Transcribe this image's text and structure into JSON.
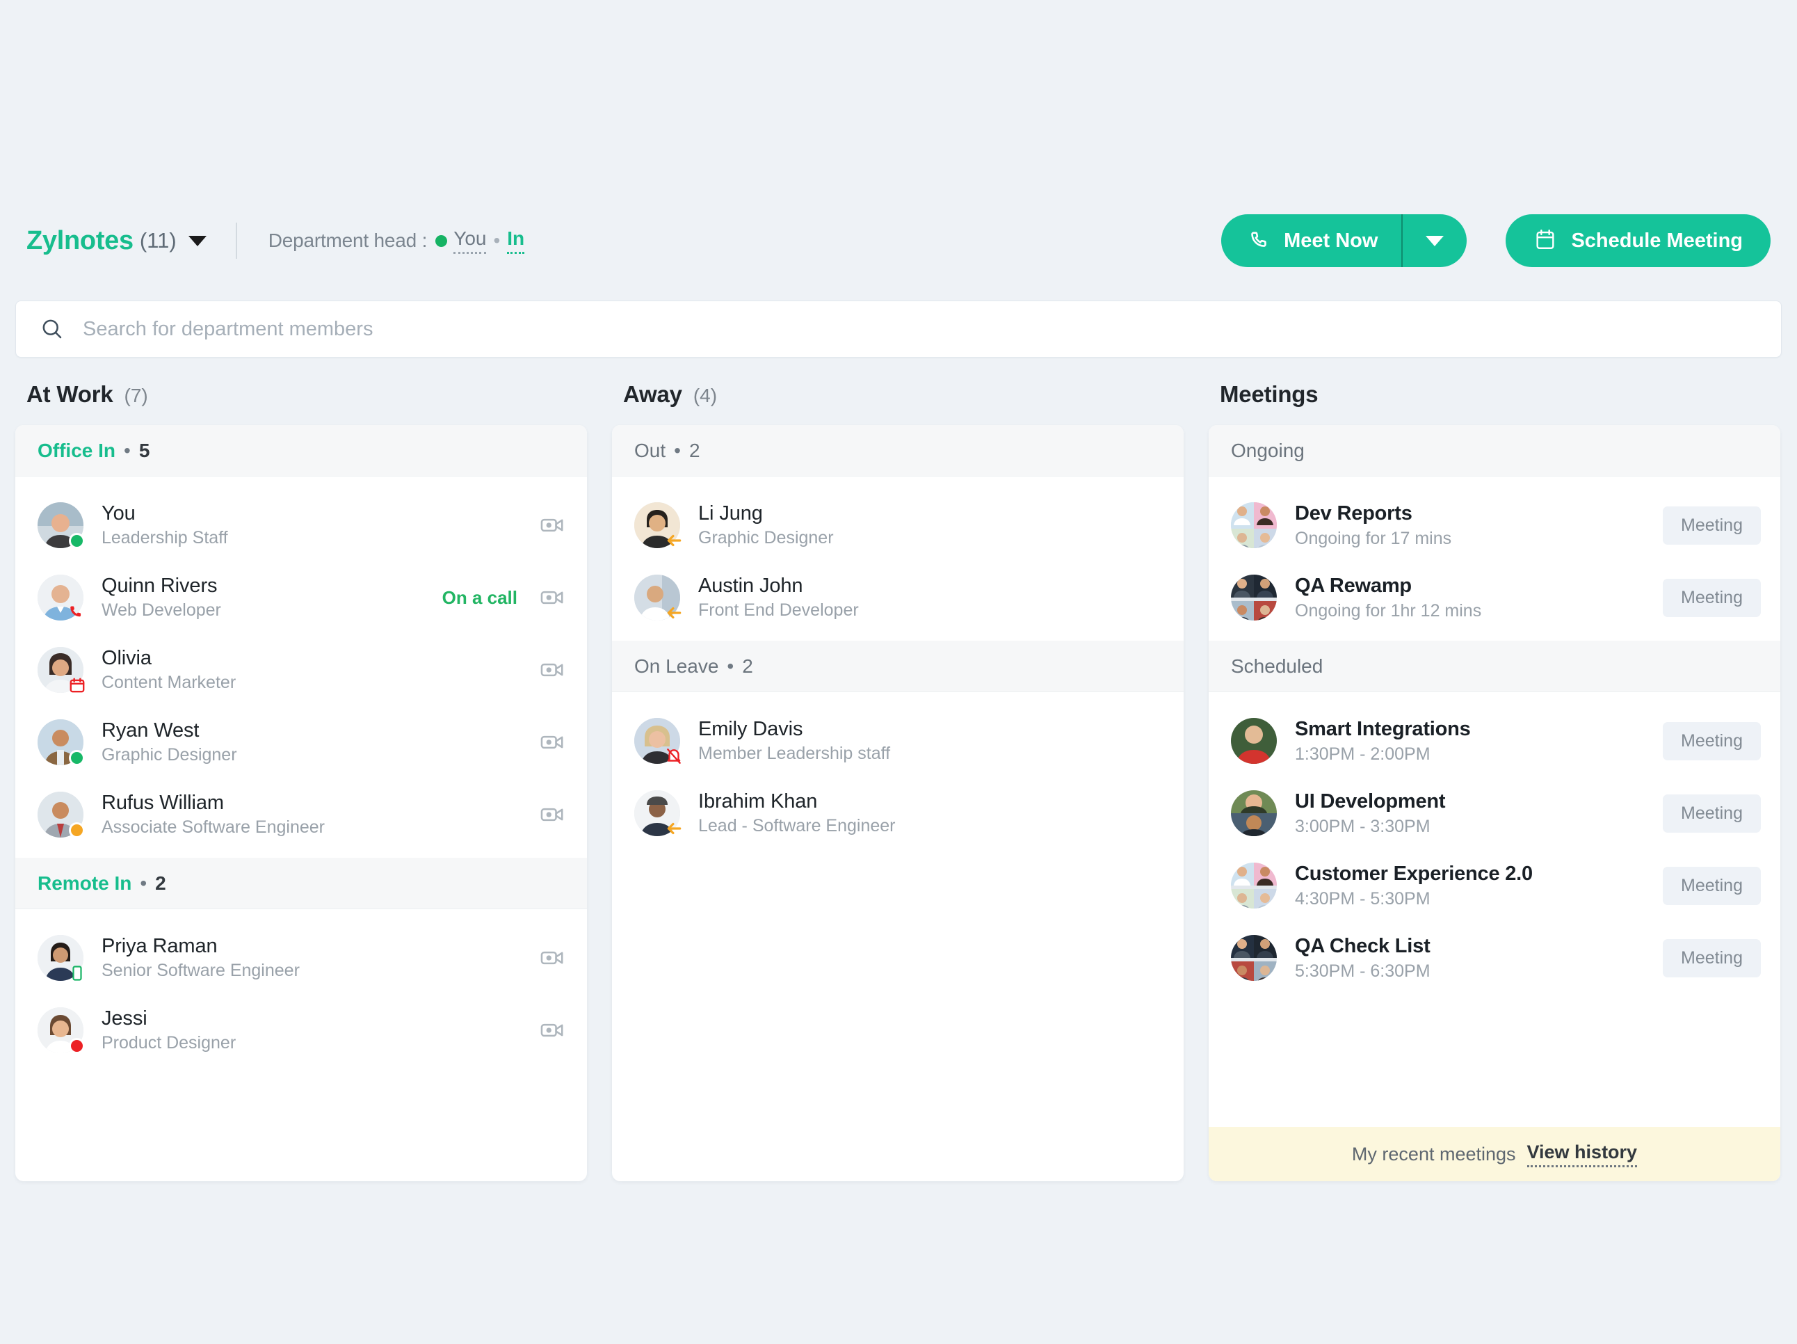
{
  "header": {
    "department_name": "Zylnotes",
    "department_count": "(11)",
    "dept_head_label": "Department head :",
    "dept_head_value": "You",
    "dept_head_separator": "•",
    "dept_head_status": "In",
    "meet_now_label": "Meet Now",
    "schedule_meeting_label": "Schedule Meeting",
    "accent_color": "#15c39a",
    "brand_color": "#17bd8d"
  },
  "search": {
    "placeholder": "Search for department members",
    "value": "",
    "icon": "search-icon"
  },
  "columns": {
    "at_work": {
      "title": "At Work",
      "count": "(7)",
      "sections": [
        {
          "name": "Office In",
          "bullet": "•",
          "count": "5",
          "name_style": "green",
          "members": [
            {
              "name": "You",
              "role": "Leadership Staff",
              "badge": "green-dot",
              "status_text": "",
              "action_icon": "video-camera-icon"
            },
            {
              "name": "Quinn Rivers",
              "role": "Web Developer",
              "badge": "red-phone",
              "status_text": "On a call",
              "action_icon": "video-camera-icon"
            },
            {
              "name": "Olivia",
              "role": "Content Marketer",
              "badge": "red-calendar",
              "status_text": "",
              "action_icon": "video-camera-icon"
            },
            {
              "name": "Ryan West",
              "role": "Graphic Designer",
              "badge": "green-dot",
              "status_text": "",
              "action_icon": "video-camera-icon"
            },
            {
              "name": "Rufus William",
              "role": "Associate Software Engineer",
              "badge": "orange-dot",
              "status_text": "",
              "action_icon": "video-camera-icon"
            }
          ]
        },
        {
          "name": "Remote In",
          "bullet": "•",
          "count": "2",
          "name_style": "green",
          "members": [
            {
              "name": "Priya Raman",
              "role": "Senior Software Engineer",
              "badge": "green-mobile",
              "status_text": "",
              "action_icon": "video-camera-icon"
            },
            {
              "name": "Jessi",
              "role": "Product Designer",
              "badge": "red-dot",
              "status_text": "",
              "action_icon": "video-camera-icon"
            }
          ]
        }
      ]
    },
    "away": {
      "title": "Away",
      "count": "(4)",
      "sections": [
        {
          "name": "Out",
          "bullet": "•",
          "count": "2",
          "name_style": "gray",
          "members": [
            {
              "name": "Li Jung",
              "role": "Graphic Designer",
              "badge": "orange-arrow-left",
              "status_text": "",
              "action_icon": ""
            },
            {
              "name": "Austin John",
              "role": "Front End Developer",
              "badge": "orange-arrow-left",
              "status_text": "",
              "action_icon": ""
            }
          ]
        },
        {
          "name": "On Leave",
          "bullet": "•",
          "count": "2",
          "name_style": "gray",
          "members": [
            {
              "name": "Emily Davis",
              "role": "Member Leadership staff",
              "badge": "red-no-bell",
              "status_text": "",
              "action_icon": ""
            },
            {
              "name": "Ibrahim Khan",
              "role": "Lead - Software Engineer",
              "badge": "orange-arrow-left",
              "status_text": "",
              "action_icon": ""
            }
          ]
        }
      ]
    },
    "meetings": {
      "title": "Meetings",
      "count": "",
      "sections": [
        {
          "name": "Ongoing",
          "name_style": "gray",
          "items": [
            {
              "title": "Dev Reports",
              "sub": "Ongoing for 17 mins",
              "pill": "Meeting",
              "avatar": "grid4"
            },
            {
              "title": "QA Rewamp",
              "sub": "Ongoing for 1hr 12 mins",
              "pill": "Meeting",
              "avatar": "grid4"
            }
          ]
        },
        {
          "name": "Scheduled",
          "name_style": "gray",
          "items": [
            {
              "title": "Smart Integrations",
              "sub": "1:30PM - 2:00PM",
              "pill": "Meeting",
              "avatar": "single"
            },
            {
              "title": "UI Development",
              "sub": "3:00PM - 3:30PM",
              "pill": "Meeting",
              "avatar": "grid2v"
            },
            {
              "title": "Customer Experience 2.0",
              "sub": "4:30PM - 5:30PM",
              "pill": "Meeting",
              "avatar": "grid4"
            },
            {
              "title": "QA Check List",
              "sub": "5:30PM - 6:30PM",
              "pill": "Meeting",
              "avatar": "grid4"
            }
          ]
        }
      ],
      "footer": {
        "text": "My recent meetings",
        "link": "View history",
        "background_color": "#fcf7dd"
      }
    }
  }
}
